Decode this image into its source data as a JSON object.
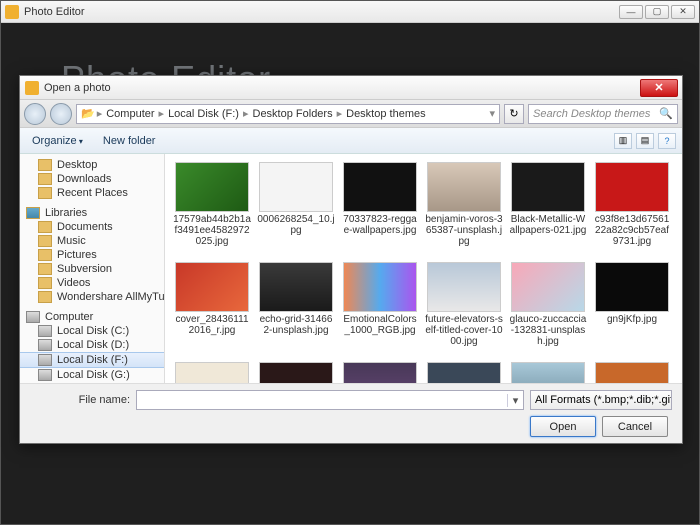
{
  "app": {
    "title": "Photo Editor",
    "bg_logo": "Photo Editor"
  },
  "dialog": {
    "title": "Open a photo",
    "breadcrumbs": [
      "Computer",
      "Local Disk (F:)",
      "Desktop Folders",
      "Desktop themes"
    ],
    "search_placeholder": "Search Desktop themes",
    "toolbar": {
      "organize": "Organize",
      "new_folder": "New folder"
    },
    "file_label": "File name:",
    "format_filter": "All Formats (*.bmp;*.dib;*.gif;*.",
    "open_btn": "Open",
    "cancel_btn": "Cancel"
  },
  "sidebar": {
    "quick": [
      {
        "label": "Desktop"
      },
      {
        "label": "Downloads"
      },
      {
        "label": "Recent Places"
      }
    ],
    "libraries_label": "Libraries",
    "libraries": [
      {
        "label": "Documents"
      },
      {
        "label": "Music"
      },
      {
        "label": "Pictures"
      },
      {
        "label": "Subversion"
      },
      {
        "label": "Videos"
      },
      {
        "label": "Wondershare AllMyTube"
      }
    ],
    "computer_label": "Computer",
    "drives": [
      {
        "label": "Local Disk (C:)"
      },
      {
        "label": "Local Disk (D:)"
      },
      {
        "label": "Local Disk (F:)",
        "selected": true
      },
      {
        "label": "Local Disk (G:)"
      }
    ]
  },
  "thumbs": [
    {
      "name": "17579ab44b2b1af3491ee4582972025.jpg",
      "bg": "linear-gradient(135deg,#3a8a2a,#1e5a14)"
    },
    {
      "name": "0006268254_10.jpg",
      "bg": "#f4f4f4"
    },
    {
      "name": "70337823-reggae-wallpapers.jpg",
      "bg": "#111"
    },
    {
      "name": "benjamin-voros-365387-unsplash.jpg",
      "bg": "linear-gradient(#d8c8b8,#a89888)"
    },
    {
      "name": "Black-Metallic-Wallpapers-021.jpg",
      "bg": "#1a1a1a"
    },
    {
      "name": "c93f8e13d6756122a82c9cb57eaf9731.jpg",
      "bg": "#c81818"
    },
    {
      "name": "cover_284361112016_r.jpg",
      "bg": "linear-gradient(135deg,#c83828,#e8683c)"
    },
    {
      "name": "echo-grid-314662-unsplash.jpg",
      "bg": "linear-gradient(#3a3a3a,#1a1a1a)"
    },
    {
      "name": "EmotionalColors_1000_RGB.jpg",
      "bg": "linear-gradient(90deg,#e85,#5ae,#a5e)"
    },
    {
      "name": "future-elevators-self-titled-cover-1000.jpg",
      "bg": "linear-gradient(#b8c8d8,#e8e8e8)"
    },
    {
      "name": "glauco-zuccaccia-132831-unsplash.jpg",
      "bg": "linear-gradient(135deg,#f8a8b8,#b8d8e8)"
    },
    {
      "name": "gn9jKfp.jpg",
      "bg": "#0a0a0a"
    },
    {
      "name": "",
      "bg": "#f0e8d8"
    },
    {
      "name": "",
      "bg": "#2a1818"
    },
    {
      "name": "",
      "bg": "linear-gradient(#483858,#684878)"
    },
    {
      "name": "",
      "bg": "#3a4858"
    },
    {
      "name": "",
      "bg": "linear-gradient(#a8c8d8,#688898)"
    },
    {
      "name": "",
      "bg": "#c8682a"
    }
  ]
}
